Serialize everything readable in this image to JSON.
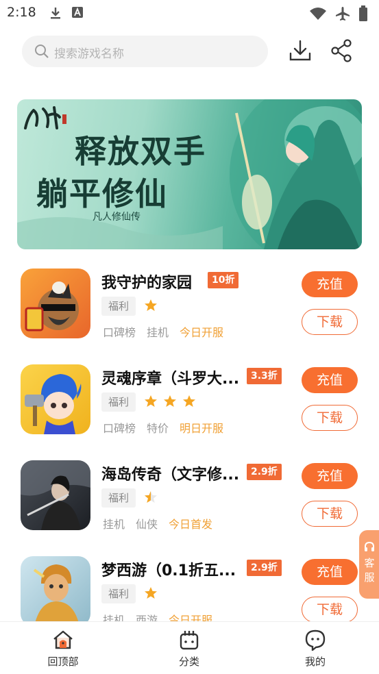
{
  "status_bar": {
    "time": "2:18",
    "icons": [
      "download-icon",
      "font-icon",
      "wifi-icon",
      "airplane-icon",
      "battery-icon"
    ]
  },
  "search": {
    "placeholder": "搜索游戏名称"
  },
  "header_icons": [
    "download-icon",
    "share-icon"
  ],
  "banner": {
    "title_line1": "释放双手",
    "title_line2": "躺平修仙",
    "subtitle": "凡人修仙传",
    "logo_text": "凡人"
  },
  "games": [
    {
      "name": "我守护的家园",
      "discount": "10折",
      "welfare": "福利",
      "stars": 1,
      "tags": [
        "口碑榜",
        "挂机"
      ],
      "highlight": "今日开服",
      "recharge_label": "充值",
      "download_label": "下载"
    },
    {
      "name": "灵魂序章（斗罗大...",
      "discount": "3.3折",
      "welfare": "福利",
      "stars": 3,
      "tags": [
        "口碑榜",
        "特价"
      ],
      "highlight": "明日开服",
      "recharge_label": "充值",
      "download_label": "下载"
    },
    {
      "name": "海岛传奇（文字修...",
      "discount": "2.9折",
      "welfare": "福利",
      "stars": 0.5,
      "tags": [
        "挂机",
        "仙侠"
      ],
      "highlight": "今日首发",
      "recharge_label": "充值",
      "download_label": "下载"
    },
    {
      "name": "梦西游（0.1折五...",
      "discount": "2.9折",
      "welfare": "福利",
      "stars": 1,
      "tags": [
        "挂机",
        "西游"
      ],
      "highlight": "今日开服",
      "recharge_label": "充值",
      "download_label": "下载"
    }
  ],
  "customer_service": {
    "label_line1": "客",
    "label_line2": "服"
  },
  "bottom_nav": {
    "home": "回顶部",
    "category": "分类",
    "mine": "我的"
  },
  "colors": {
    "accent": "#f86f30",
    "highlight_text": "#f0a035",
    "star": "#f5a623"
  }
}
